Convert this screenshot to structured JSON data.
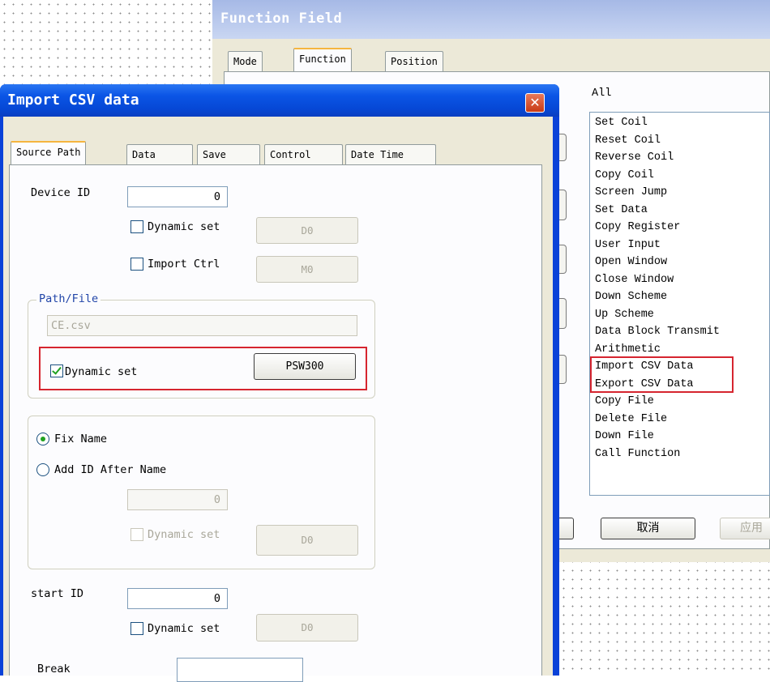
{
  "back_window": {
    "title": "Function Field",
    "tabs": [
      "Mode",
      "Function",
      "Position"
    ],
    "list_header": "All",
    "functions": [
      "Set Coil",
      "Reset Coil",
      "Reverse Coil",
      "Copy Coil",
      "Screen Jump",
      "Set Data",
      "Copy Register",
      "User Input",
      "Open Window",
      "Close Window",
      "Down Scheme",
      "Up Scheme",
      "Data Block Transmit",
      "Arithmetic",
      "Import CSV Data",
      "Export CSV Data",
      "Copy File",
      "Delete File",
      "Down File",
      "Call Function"
    ],
    "highlighted_functions": [
      "Import CSV Data",
      "Export CSV Data"
    ],
    "cancel_label": "取消",
    "apply_label": "应用"
  },
  "dialog": {
    "title": "Import CSV data",
    "close_icon": "close-icon",
    "tabs": [
      "Source Path",
      "Data",
      "Save",
      "Control",
      "Date Time"
    ],
    "active_tab": "Source Path",
    "device_id": {
      "label": "Device ID",
      "value": "0"
    },
    "dynamic_set_1": {
      "label": "Dynamic set",
      "checked": false,
      "button": "D0"
    },
    "import_ctrl": {
      "label": "Import Ctrl",
      "checked": false,
      "button": "M0"
    },
    "path_file": {
      "legend": "Path/File",
      "file_value": "CE.csv",
      "dynamic_set_label": "Dynamic set",
      "dynamic_set_checked": true,
      "button": "PSW300"
    },
    "naming": {
      "fix_name": {
        "label": "Fix Name",
        "selected": true
      },
      "add_id": {
        "label": "Add ID After Name",
        "selected": false
      },
      "id_value": "0",
      "dynamic_set_label": "Dynamic set",
      "button": "D0"
    },
    "start_id": {
      "label": "start ID",
      "value": "0",
      "dynamic_set_label": "Dynamic set",
      "button": "D0"
    },
    "break_label": "Break"
  },
  "colors": {
    "highlight_red": "#d6252f",
    "xp_title_blue": "#0b55e6",
    "dialog_bg": "#ece9d8",
    "back_title": "#a6b9e6"
  }
}
